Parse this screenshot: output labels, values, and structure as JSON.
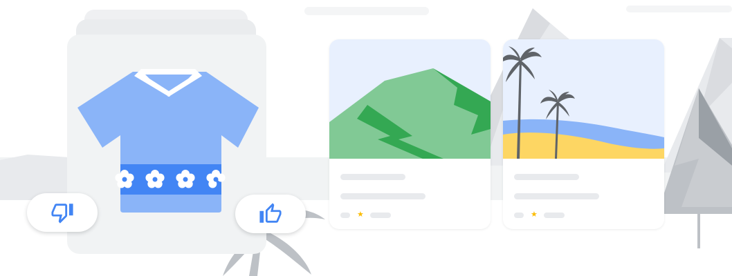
{
  "colors": {
    "accent_blue": "#4285f4",
    "light_blue": "#8ab4f8",
    "mid_blue": "#669df6",
    "green_dark": "#34a853",
    "green_light": "#81c995",
    "sand_yellow": "#fdd663",
    "star_yellow": "#fbbc04",
    "sky": "#e8f0fe",
    "palm_dark": "#5f6368",
    "gray_bg": "#e8eaed"
  },
  "icons": {
    "dislike": "thumbs-down-icon",
    "like": "thumbs-up-icon",
    "star": "star-icon"
  },
  "cards": [
    {
      "thumbnail": "mountain-illustration",
      "rating_glyph": "★"
    },
    {
      "thumbnail": "beach-palm-illustration",
      "rating_glyph": "★"
    }
  ]
}
